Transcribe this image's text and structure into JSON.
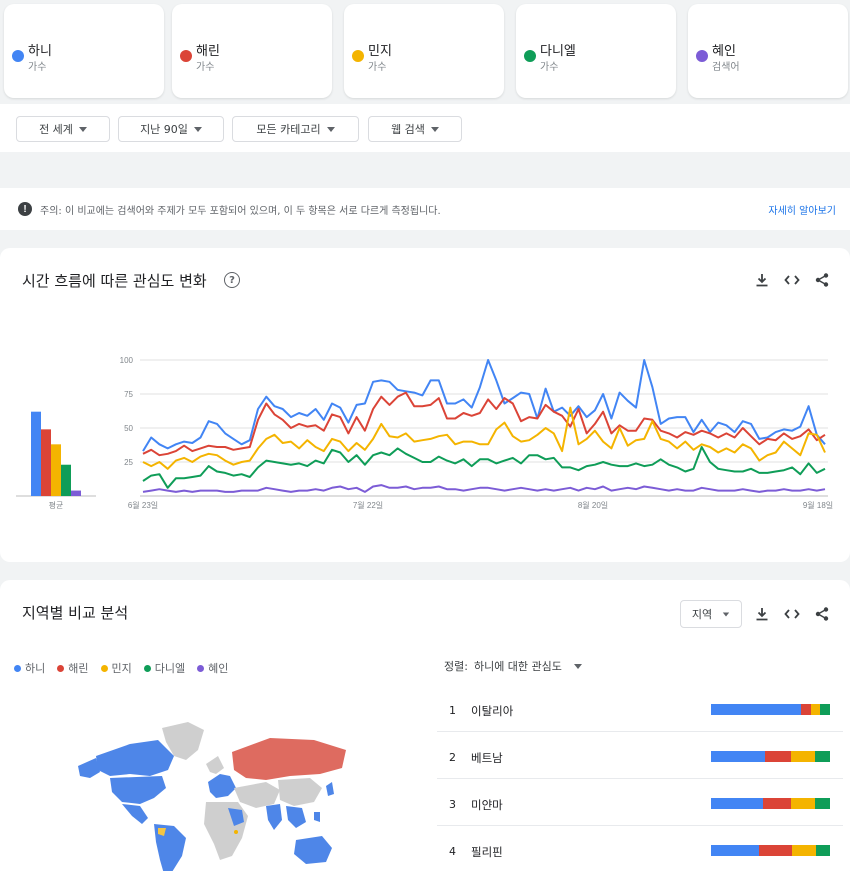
{
  "terms": [
    {
      "name": "하니",
      "sub": "가수",
      "color": "#4285f4"
    },
    {
      "name": "해린",
      "sub": "가수",
      "color": "#db4437"
    },
    {
      "name": "민지",
      "sub": "가수",
      "color": "#f4b400"
    },
    {
      "name": "다니엘",
      "sub": "가수",
      "color": "#0f9d58"
    },
    {
      "name": "혜인",
      "sub": "검색어",
      "color": "#7c5cd6"
    }
  ],
  "filters": {
    "region": "전 세계",
    "time": "지난 90일",
    "category": "모든 카테고리",
    "search_type": "웹 검색"
  },
  "notice": {
    "icon": "!",
    "text": "주의: 이 비교에는 검색어와 주제가 모두 포함되어 있으며, 이 두 항목은 서로 다르게 측정됩니다.",
    "link": "자세히 알아보기"
  },
  "interest_over_time": {
    "title": "시간 흐름에 따른 관심도 변화",
    "help": "?"
  },
  "chart_data": {
    "type": "line",
    "y_ticks": [
      "100",
      "75",
      "50",
      "25"
    ],
    "ylim": [
      0,
      100
    ],
    "x_ticks": [
      "6월 23일",
      "7월 22일",
      "8월 20일",
      "9월 18일"
    ],
    "avg_label": "평균",
    "averages": [
      62,
      49,
      38,
      23,
      4
    ],
    "series": [
      {
        "name": "하니",
        "color": "#4285f4",
        "values": [
          33,
          43,
          38,
          35,
          38,
          40,
          39,
          43,
          55,
          53,
          46,
          42,
          38,
          41,
          64,
          73,
          66,
          64,
          58,
          61,
          59,
          64,
          56,
          68,
          65,
          54,
          67,
          68,
          84,
          85,
          84,
          78,
          77,
          76,
          74,
          85,
          85,
          68,
          68,
          71,
          65,
          80,
          100,
          85,
          68,
          72,
          76,
          75,
          57,
          79,
          62,
          65,
          59,
          66,
          58,
          63,
          75,
          57,
          76,
          70,
          65,
          100,
          80,
          53,
          57,
          58,
          58,
          47,
          56,
          47,
          54,
          52,
          47,
          55,
          53,
          42,
          43,
          47,
          49,
          48,
          51,
          66,
          45,
          38
        ]
      },
      {
        "name": "해린",
        "color": "#db4437",
        "values": [
          31,
          34,
          30,
          31,
          33,
          37,
          33,
          35,
          37,
          36,
          36,
          34,
          35,
          36,
          56,
          68,
          60,
          56,
          50,
          53,
          51,
          52,
          48,
          60,
          58,
          46,
          58,
          48,
          64,
          73,
          67,
          73,
          76,
          66,
          66,
          67,
          72,
          57,
          57,
          61,
          59,
          61,
          71,
          64,
          72,
          68,
          55,
          58,
          57,
          67,
          62,
          59,
          51,
          64,
          46,
          53,
          62,
          46,
          52,
          48,
          48,
          57,
          56,
          48,
          46,
          43,
          47,
          45,
          48,
          46,
          43,
          46,
          43,
          50,
          44,
          38,
          42,
          41,
          46,
          42,
          44,
          49,
          41,
          45
        ]
      },
      {
        "name": "민지",
        "color": "#f4b400",
        "values": [
          25,
          22,
          25,
          20,
          26,
          28,
          25,
          29,
          31,
          30,
          26,
          23,
          25,
          26,
          35,
          42,
          45,
          39,
          40,
          35,
          41,
          36,
          33,
          42,
          40,
          33,
          39,
          34,
          42,
          53,
          44,
          43,
          46,
          40,
          41,
          42,
          44,
          45,
          38,
          40,
          40,
          38,
          38,
          49,
          54,
          44,
          40,
          41,
          45,
          50,
          46,
          33,
          65,
          38,
          42,
          48,
          40,
          35,
          50,
          37,
          41,
          42,
          55,
          42,
          40,
          35,
          40,
          34,
          38,
          36,
          32,
          35,
          32,
          38,
          35,
          26,
          30,
          32,
          40,
          35,
          30,
          46,
          45,
          32
        ]
      },
      {
        "name": "다니엘",
        "color": "#0f9d58",
        "values": [
          11,
          15,
          16,
          6,
          13,
          13,
          14,
          15,
          22,
          18,
          17,
          15,
          16,
          14,
          21,
          26,
          25,
          24,
          23,
          24,
          22,
          26,
          24,
          34,
          32,
          25,
          30,
          23,
          30,
          32,
          30,
          35,
          31,
          28,
          25,
          25,
          29,
          26,
          24,
          27,
          22,
          27,
          27,
          24,
          26,
          28,
          24,
          30,
          30,
          27,
          28,
          21,
          21,
          19,
          22,
          23,
          25,
          23,
          22,
          22,
          24,
          22,
          23,
          27,
          23,
          21,
          18,
          20,
          36,
          25,
          20,
          19,
          18,
          18,
          20,
          17,
          17,
          18,
          19,
          21,
          16,
          24,
          17,
          20
        ]
      },
      {
        "name": "혜인",
        "color": "#7c5cd6",
        "values": [
          3,
          4,
          5,
          4,
          3,
          4,
          3,
          4,
          4,
          4,
          3,
          3,
          4,
          4,
          4,
          6,
          5,
          4,
          3,
          4,
          4,
          5,
          4,
          6,
          7,
          5,
          6,
          3,
          7,
          8,
          6,
          6,
          7,
          5,
          6,
          6,
          7,
          5,
          5,
          4,
          5,
          6,
          6,
          5,
          4,
          5,
          6,
          5,
          4,
          5,
          4,
          5,
          6,
          4,
          6,
          5,
          7,
          4,
          5,
          6,
          5,
          7,
          6,
          5,
          4,
          5,
          4,
          4,
          6,
          5,
          4,
          4,
          4,
          5,
          4,
          3,
          4,
          4,
          5,
          4,
          4,
          5,
          4,
          5
        ]
      }
    ]
  },
  "regional": {
    "title": "지역별 비교 분석",
    "selector": "지역",
    "legend": [
      {
        "name": "하니",
        "color": "#4285f4"
      },
      {
        "name": "해린",
        "color": "#db4437"
      },
      {
        "name": "민지",
        "color": "#f4b400"
      },
      {
        "name": "다니엘",
        "color": "#0f9d58"
      },
      {
        "name": "혜인",
        "color": "#7c5cd6"
      }
    ],
    "sort_label": "정렬:",
    "sort_value": "하니에 대한 관심도",
    "rows": [
      {
        "rank": "1",
        "name": "이탈리아",
        "shares": [
          76,
          8,
          8,
          8
        ]
      },
      {
        "rank": "2",
        "name": "베트남",
        "shares": [
          45,
          22,
          20,
          13
        ]
      },
      {
        "rank": "3",
        "name": "미얀마",
        "shares": [
          44,
          23,
          20,
          13
        ]
      },
      {
        "rank": "4",
        "name": "필리핀",
        "shares": [
          40,
          28,
          20,
          12
        ]
      }
    ]
  }
}
